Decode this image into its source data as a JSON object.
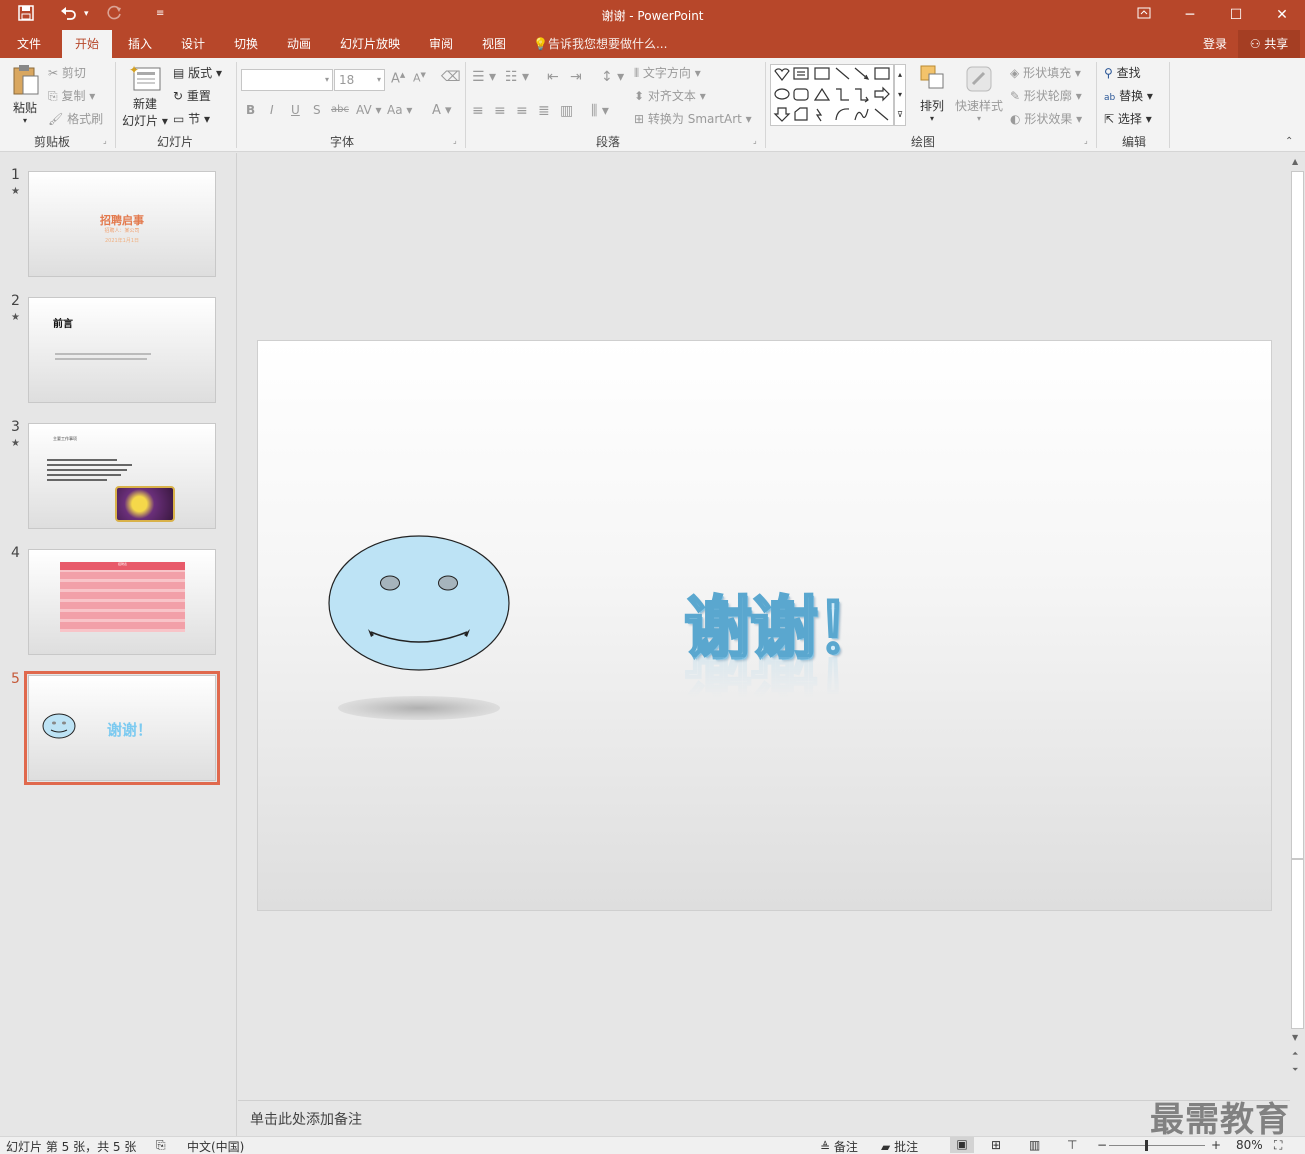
{
  "window": {
    "title": "谢谢 - PowerPoint"
  },
  "quick_access": {
    "save_icon": "save-icon",
    "undo_icon": "undo-icon",
    "redo_icon": "redo-icon",
    "customize_icon": "customize-icon"
  },
  "window_controls": {
    "ribbon_display": "ribbon-display-icon",
    "minimize": "minimize-icon",
    "maximize": "maximize-icon",
    "close": "close-icon"
  },
  "tabs": [
    {
      "label": "文件"
    },
    {
      "label": "开始"
    },
    {
      "label": "插入"
    },
    {
      "label": "设计"
    },
    {
      "label": "切换"
    },
    {
      "label": "动画"
    },
    {
      "label": "幻灯片放映"
    },
    {
      "label": "审阅"
    },
    {
      "label": "视图"
    }
  ],
  "tell_me": "告诉我您想要做什么...",
  "account": {
    "login": "登录",
    "share": "共享"
  },
  "ribbon": {
    "clipboard": {
      "paste": "粘贴",
      "cut": "剪切",
      "copy": "复制",
      "format_painter": "格式刷",
      "label": "剪贴板"
    },
    "slides": {
      "new_slide_1": "新建",
      "new_slide_2": "幻灯片",
      "layout": "版式",
      "reset": "重置",
      "section": "节",
      "label": "幻灯片"
    },
    "font": {
      "font_name": "",
      "font_size": "18",
      "bold": "B",
      "italic": "I",
      "underline": "U",
      "shadow": "S",
      "strike": "abc",
      "spacing": "AV",
      "case": "Aa",
      "color": "A",
      "label": "字体"
    },
    "paragraph": {
      "text_direction": "文字方向",
      "align_text": "对齐文本",
      "convert_smartart": "转换为 SmartArt",
      "label": "段落"
    },
    "drawing": {
      "arrange": "排列",
      "quick_styles": "快速样式",
      "shape_fill": "形状填充",
      "shape_outline": "形状轮廓",
      "shape_effects": "形状效果",
      "label": "绘图"
    },
    "editing": {
      "find": "查找",
      "replace": "替换",
      "select": "选择",
      "label": "编辑"
    }
  },
  "slides": [
    {
      "number": "1",
      "star": "★",
      "title": "招聘启事",
      "subtitle": "招聘人：某公司",
      "date": "2021年1月1日"
    },
    {
      "number": "2",
      "star": "★",
      "title": "前言"
    },
    {
      "number": "3",
      "star": "★",
      "title": "主要工作事项"
    },
    {
      "number": "4",
      "star": "",
      "title": "招聘表"
    },
    {
      "number": "5",
      "star": "",
      "title": "谢谢！"
    }
  ],
  "current_slide": {
    "text": "谢谢！"
  },
  "notes_placeholder": "单击此处添加备注",
  "watermark": "最需教育",
  "status": {
    "slide_info": "幻灯片 第 5 张，共 5 张",
    "language": "中文(中国)",
    "notes": "备注",
    "comments": "批注",
    "zoom": "80%",
    "zoom_level": 0.8
  }
}
